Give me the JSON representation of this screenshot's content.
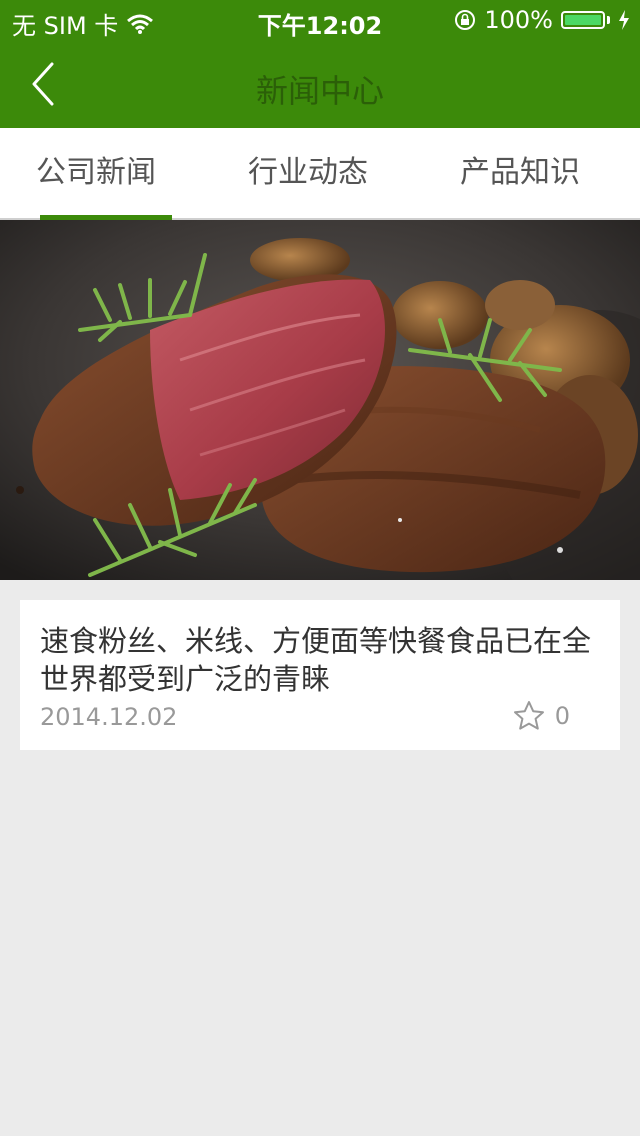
{
  "status_bar": {
    "carrier": "无 SIM 卡",
    "time": "下午12:02",
    "battery": "100%",
    "battery_level": 1.0
  },
  "nav": {
    "title": "新闻中心"
  },
  "tabs": [
    {
      "label": "公司新闻",
      "active": true
    },
    {
      "label": "行业动态",
      "active": false
    },
    {
      "label": "产品知识",
      "active": false
    }
  ],
  "news": [
    {
      "title": "速食粉丝、米线、方便面等快餐食品已在全世界都受到广泛的青睐",
      "date": "2014.12.02",
      "favorites": "0"
    }
  ],
  "colors": {
    "brand_green": "#3c8a0a",
    "background": "#ebebeb"
  }
}
